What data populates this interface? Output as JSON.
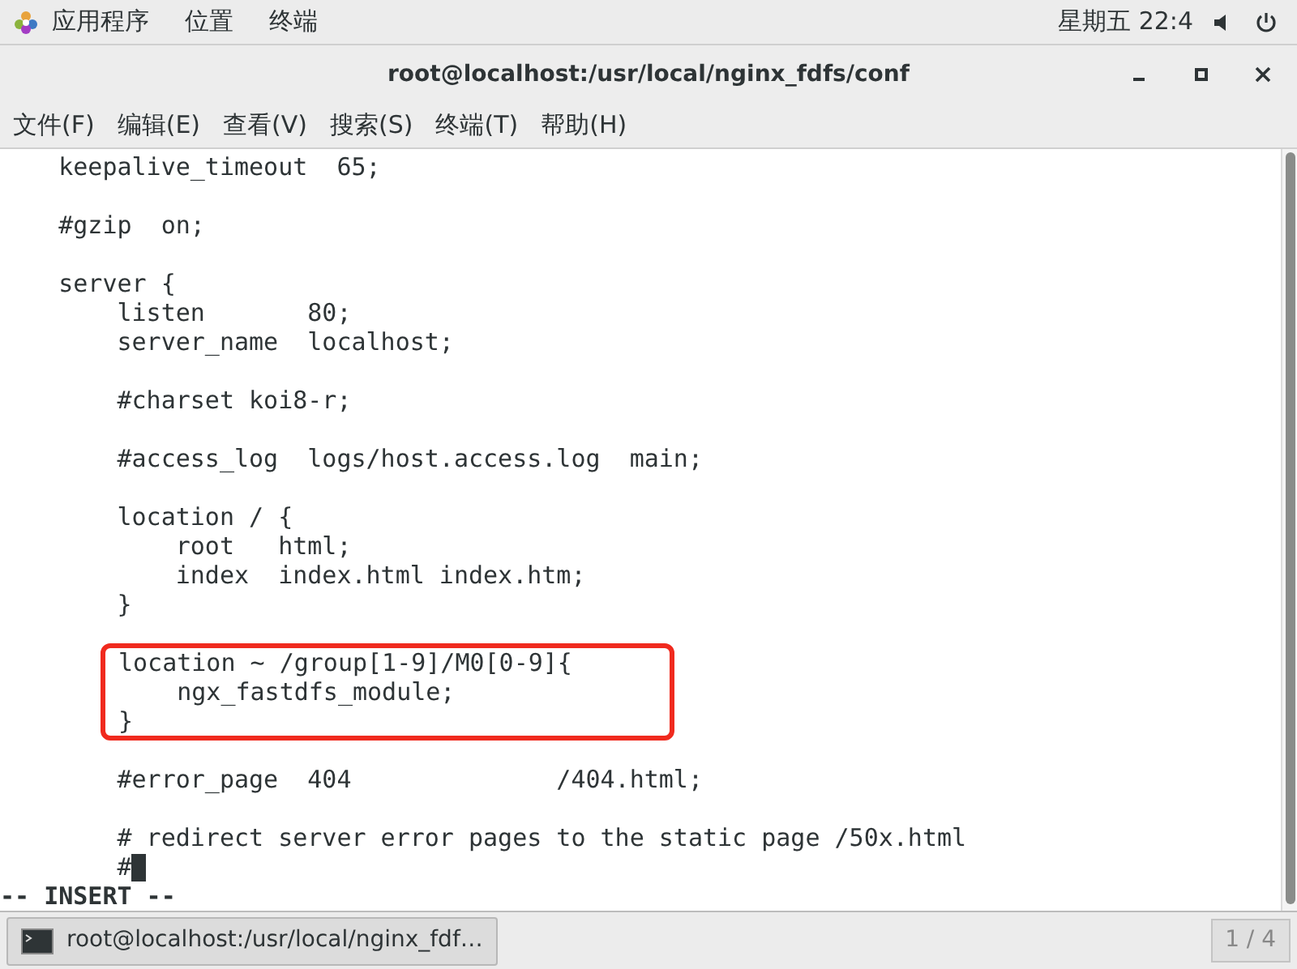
{
  "top_panel": {
    "menus": [
      "应用程序",
      "位置",
      "终端"
    ],
    "clock": "星期五 22:4"
  },
  "window": {
    "title": "root@localhost:/usr/local/nginx_fdfs/conf"
  },
  "menu_bar": [
    "文件(F)",
    "编辑(E)",
    "查看(V)",
    "搜索(S)",
    "终端(T)",
    "帮助(H)"
  ],
  "editor": {
    "groups": [
      {
        "highlighted": false,
        "cursor_at_end": false,
        "lines": [
          "    keepalive_timeout  65;"
        ]
      },
      {
        "highlighted": false,
        "cursor_at_end": false,
        "lines": [
          "    #gzip  on;"
        ]
      },
      {
        "highlighted": false,
        "cursor_at_end": false,
        "lines": [
          "    server {",
          "        listen       80;",
          "        server_name  localhost;"
        ]
      },
      {
        "highlighted": false,
        "cursor_at_end": false,
        "lines": [
          "        #charset koi8-r;"
        ]
      },
      {
        "highlighted": false,
        "cursor_at_end": false,
        "lines": [
          "        #access_log  logs/host.access.log  main;"
        ]
      },
      {
        "highlighted": false,
        "cursor_at_end": false,
        "lines": [
          "        location / {",
          "            root   html;",
          "            index  index.html index.htm;",
          "        }"
        ]
      },
      {
        "highlighted": true,
        "cursor_at_end": false,
        "lines": [
          "location ~ /group[1-9]/M0[0-9]{",
          "    ngx_fastdfs_module;",
          "}"
        ]
      },
      {
        "highlighted": false,
        "cursor_at_end": false,
        "lines": [
          "        #error_page  404              /404.html;"
        ]
      },
      {
        "highlighted": false,
        "cursor_at_end": true,
        "lines": [
          "        # redirect server error pages to the static page /50x.html",
          "        #"
        ]
      }
    ],
    "mode": "-- INSERT --"
  },
  "taskbar": {
    "task": "root@localhost:/usr/local/nginx_fdf…",
    "workspace": "1 / 4"
  }
}
